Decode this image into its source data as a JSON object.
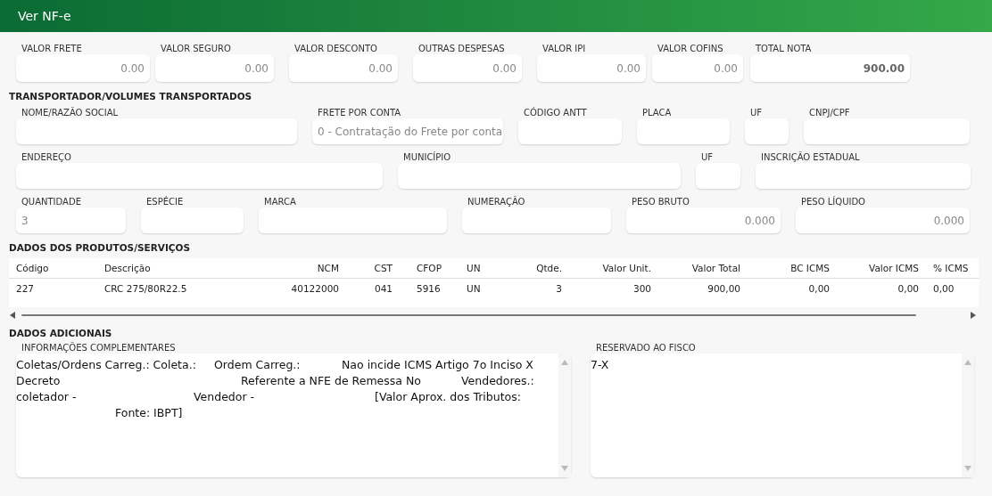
{
  "window": {
    "title": "Ver NF-e"
  },
  "totals": [
    {
      "label": "VALOR FRETE",
      "value": "0.00"
    },
    {
      "label": "VALOR SEGURO",
      "value": "0.00"
    },
    {
      "label": "VALOR DESCONTO",
      "value": "0.00"
    },
    {
      "label": "OUTRAS DESPESAS",
      "value": "0.00"
    },
    {
      "label": "VALOR IPI",
      "value": "0.00"
    },
    {
      "label": "VALOR COFINS",
      "value": "0.00"
    },
    {
      "label": "TOTAL NOTA",
      "value": "900.00",
      "emphasis": true
    }
  ],
  "transport": {
    "title": "TRANSPORTADOR/VOLUMES TRANSPORTADOS",
    "groups": [
      {
        "fields": [
          {
            "label": "NOME/RAZÃO SOCIAL"
          },
          {
            "label": "FRETE POR CONTA",
            "value": "0 - Contratação do Frete por conta",
            "kind": "text"
          },
          {
            "label": "CÓDIGO ANTT"
          },
          {
            "label": "PLACA"
          },
          {
            "label": "UF"
          },
          {
            "label": "CNPJ/CPF"
          }
        ]
      },
      {
        "fields": [
          {
            "label": "ENDEREÇO"
          },
          {
            "label": "MUNICÍPIO"
          },
          {
            "label": "UF"
          },
          {
            "label": "INSCRIÇÃO ESTADUAL"
          }
        ]
      },
      {
        "fields": [
          {
            "label": "QUANTIDADE",
            "value": "3",
            "kind": "text"
          },
          {
            "label": "ESPÉCIE"
          },
          {
            "label": "MARCA"
          },
          {
            "label": "NUMERAÇÃO"
          },
          {
            "label": "PESO BRUTO",
            "value": "0.000",
            "kind": "number"
          },
          {
            "label": "PESO LÍQUIDO",
            "value": "0.000",
            "kind": "number"
          }
        ]
      }
    ]
  },
  "products": {
    "title": "DADOS DOS PRODUTOS/SERVIÇOS",
    "columns": [
      "Código",
      "Descrição",
      "NCM",
      "CST",
      "CFOP",
      "UN",
      "Qtde.",
      "Valor Unit.",
      "Valor Total",
      "BC ICMS",
      "Valor ICMS",
      "% ICMS"
    ],
    "rows": [
      [
        "227",
        "CRC 275/80R22.5",
        "40122000",
        "041",
        "5916",
        "UN",
        "3",
        "300",
        "900,00",
        "0,00",
        "0,00",
        "0,00"
      ]
    ]
  },
  "additional": {
    "title": "DADOS ADICIONAIS",
    "complementary": {
      "label": "INFORMAÇÕES COMPLEMENTARES",
      "lines": [
        [
          "Coletas/Ordens Carreg.: Coleta.:",
          "Ordem Carreg.:",
          "Nao incide ICMS Artigo 7o Inciso X"
        ],
        [
          "Decreto",
          "Referente a NFE de Remessa No",
          "Vendedores.:"
        ],
        [
          "coletador -",
          "Vendedor -",
          "[Valor Aprox. dos Tributos:"
        ],
        [
          "Fonte: IBPT]"
        ]
      ]
    },
    "fiscal": {
      "label": "RESERVADO AO FISCO",
      "lines": [
        [
          "7-X"
        ]
      ]
    }
  }
}
